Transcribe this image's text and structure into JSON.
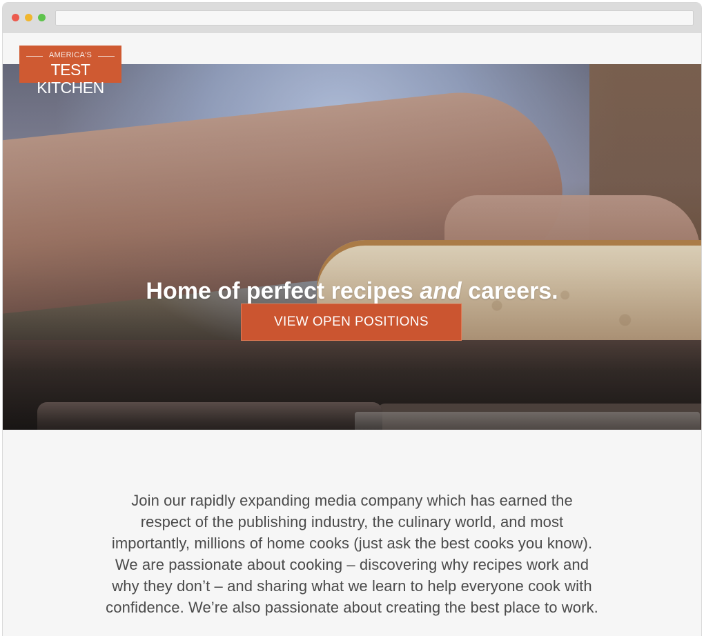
{
  "browser": {
    "window_controls": [
      "close-icon",
      "minimize-icon",
      "maximize-icon"
    ],
    "colors": {
      "close": "#ec5b4e",
      "minimize": "#f0b62e",
      "maximize": "#5ec34c"
    },
    "address_bar_value": ""
  },
  "site": {
    "logo": {
      "top": "AMERICA'S",
      "main": "TEST KITCHEN"
    },
    "hero": {
      "title_part_1": "Home of perfect recipes ",
      "title_part_2": "and",
      "title_part_3": " careers.",
      "cta_label": "VIEW OPEN POSITIONS"
    },
    "intro_text": "Join our rapidly expanding media company which has earned the\nrespect of the publishing industry, the culinary world, and most\nimportantly, millions of home cooks (just ask the best cooks you know).\nWe are passionate about cooking – discovering why recipes work and\nwhy they don’t – and sharing what we learn to help everyone cook with\nconfidence. We’re also passionate about creating the best place to work."
  }
}
